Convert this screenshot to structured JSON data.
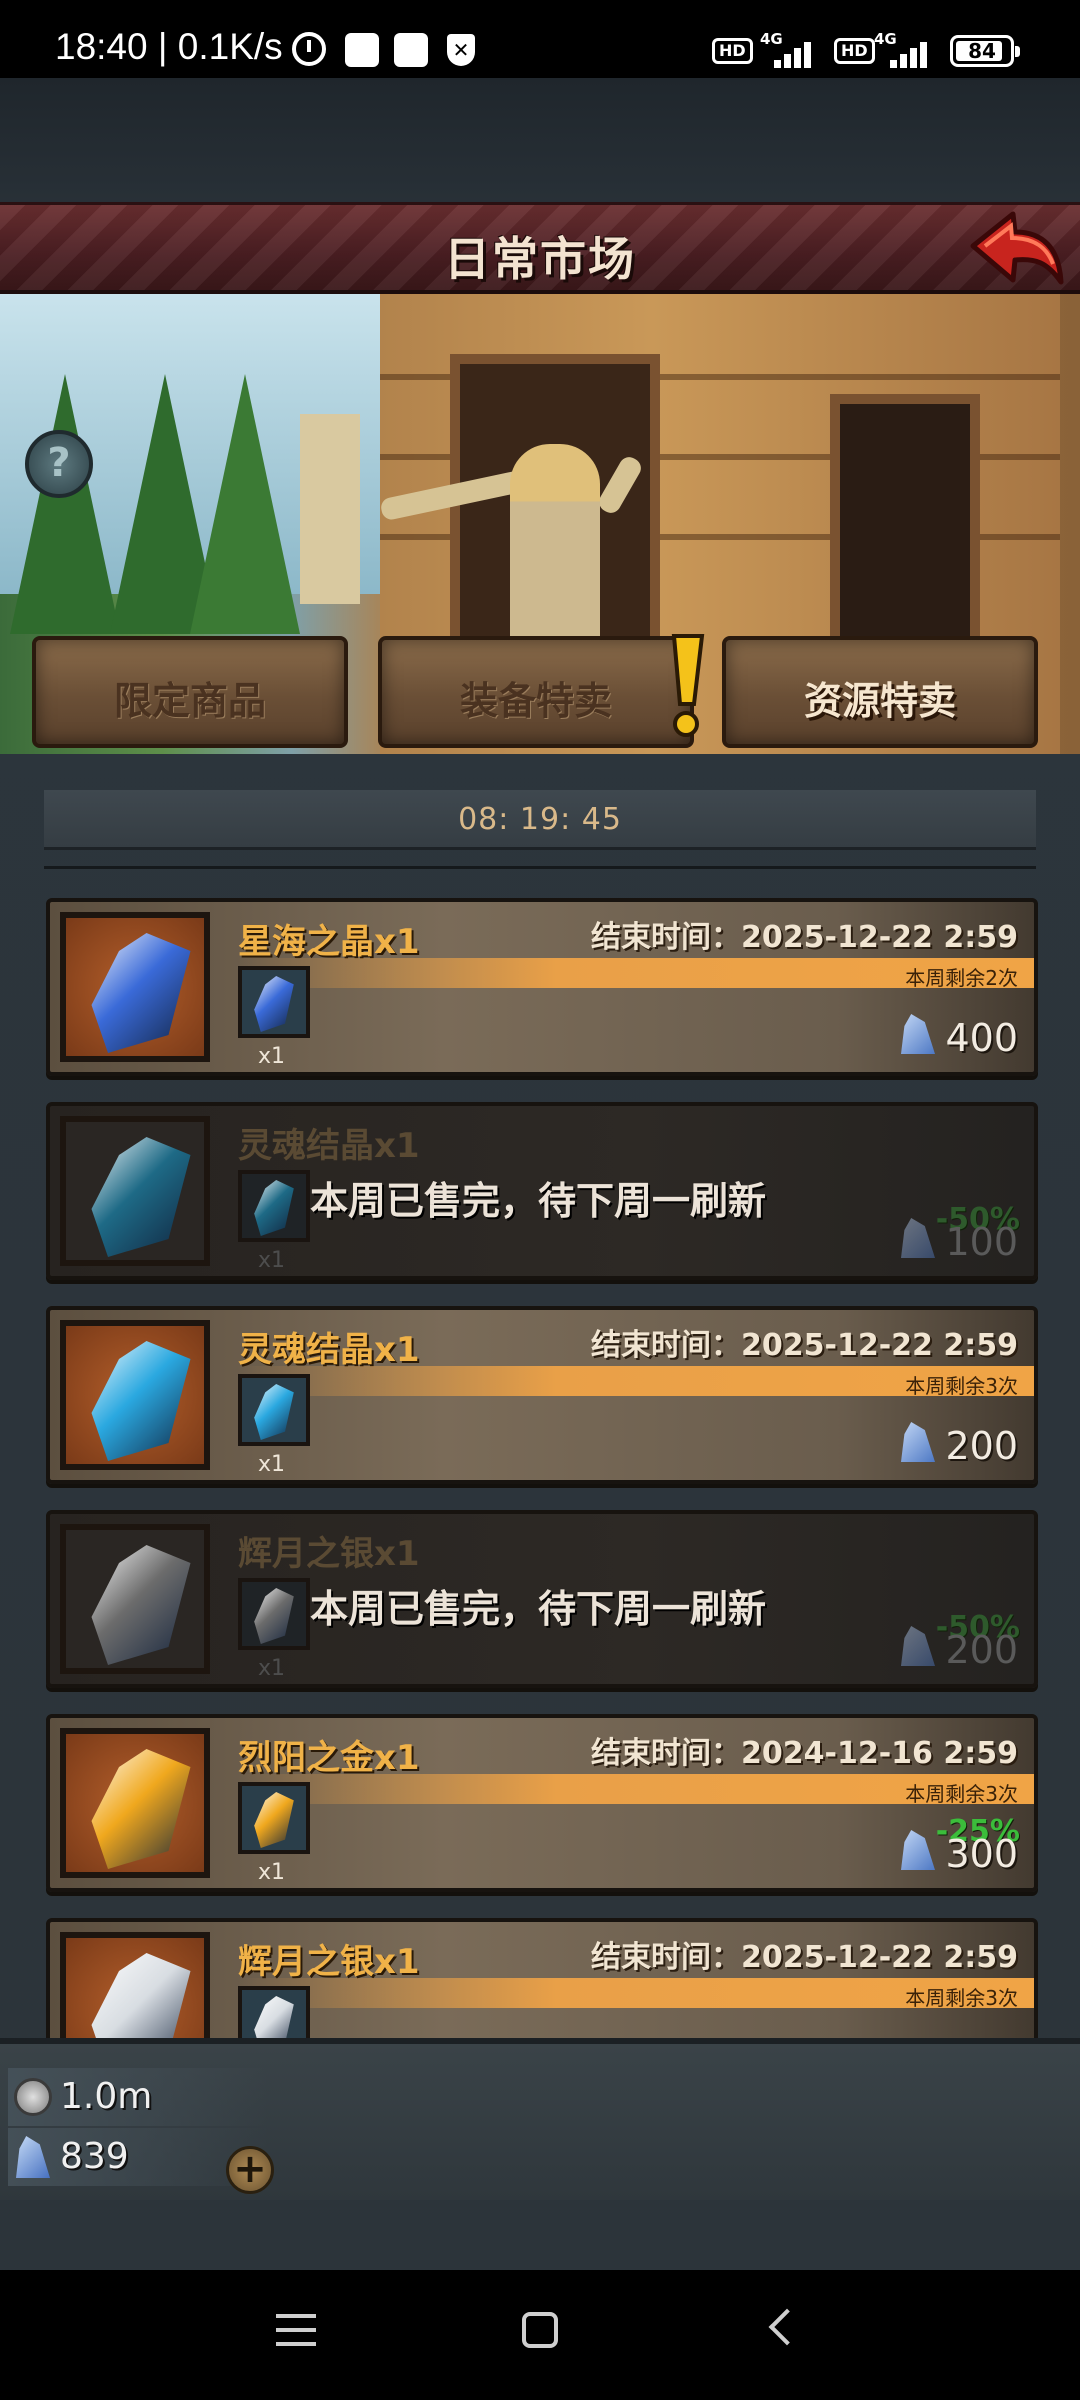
{
  "status_bar": {
    "time": "18:40 | 0.1K/s",
    "network_label": "4G",
    "hd_label": "HD",
    "battery": "84"
  },
  "market": {
    "title": "日常市场",
    "tabs": [
      {
        "label": "限定商品",
        "active": false
      },
      {
        "label": "装备特卖",
        "active": false,
        "alert": true
      },
      {
        "label": "资源特卖",
        "active": true
      }
    ],
    "countdown": "08: 19: 45"
  },
  "items": [
    {
      "name": "星海之晶x1",
      "end_time": "结束时间：2025-12-22 2:59",
      "quota": "本周剩余2次",
      "qty": "x1",
      "price": "400",
      "discount": "",
      "sold_out": false,
      "gem_color": "#3a6ad8"
    },
    {
      "name": "灵魂结晶x1",
      "end_time": "",
      "quota": "",
      "qty": "x1",
      "price": "100",
      "discount": "-50%",
      "sold_out": true,
      "sold_out_text": "本周已售完，待下周一刷新",
      "gem_color": "#1e6a86"
    },
    {
      "name": "灵魂结晶x1",
      "end_time": "结束时间：2025-12-22 2:59",
      "quota": "本周剩余3次",
      "qty": "x1",
      "price": "200",
      "discount": "",
      "sold_out": false,
      "gem_color": "#2aa8e0"
    },
    {
      "name": "辉月之银x1",
      "end_time": "",
      "quota": "",
      "qty": "x1",
      "price": "200",
      "discount": "-50%",
      "sold_out": true,
      "sold_out_text": "本周已售完，待下周一刷新",
      "gem_color": "#6c6c6c"
    },
    {
      "name": "烈阳之金x1",
      "end_time": "结束时间：2024-12-16 2:59",
      "quota": "本周剩余3次",
      "qty": "x1",
      "price": "300",
      "discount": "-25%",
      "sold_out": false,
      "gem_color": "#f0a81e"
    },
    {
      "name": "辉月之银x1",
      "end_time": "结束时间：2025-12-22 2:59",
      "quota": "本周剩余3次",
      "qty": "x1",
      "price": "",
      "discount": "",
      "sold_out": false,
      "gem_color": "#d8dde2"
    }
  ],
  "currencies": {
    "silver": "1.0m",
    "gems": "839"
  },
  "icons": {
    "help": "?",
    "add": "+",
    "alert": "!"
  }
}
